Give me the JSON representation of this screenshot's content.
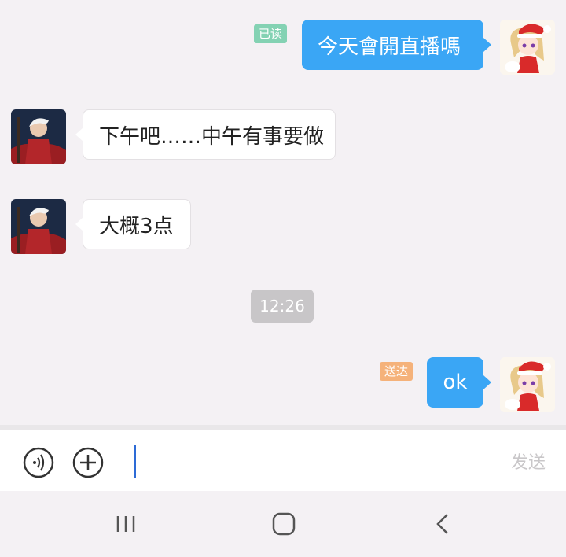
{
  "messages": [
    {
      "direction": "out",
      "text": "今天會開直播嗎",
      "status": "已读",
      "status_color": "#84d2b3"
    },
    {
      "direction": "in",
      "text": "下午吧……中午有事要做"
    },
    {
      "direction": "in",
      "text": "大概3点"
    },
    {
      "direction": "out",
      "text": "ok",
      "status": "送达",
      "status_color": "#f5b27a"
    }
  ],
  "timestamp": "12:26",
  "input": {
    "value": "",
    "placeholder": ""
  },
  "send_label": "发送",
  "icons": {
    "voice": "voice-icon",
    "plus": "plus-icon",
    "recents": "recent-apps-icon",
    "home": "home-icon",
    "back": "back-icon"
  },
  "colors": {
    "outgoing_bubble": "#3aa6f5",
    "incoming_bubble": "#ffffff",
    "background": "#f4f1f4",
    "cursor": "#2d6bd6"
  }
}
